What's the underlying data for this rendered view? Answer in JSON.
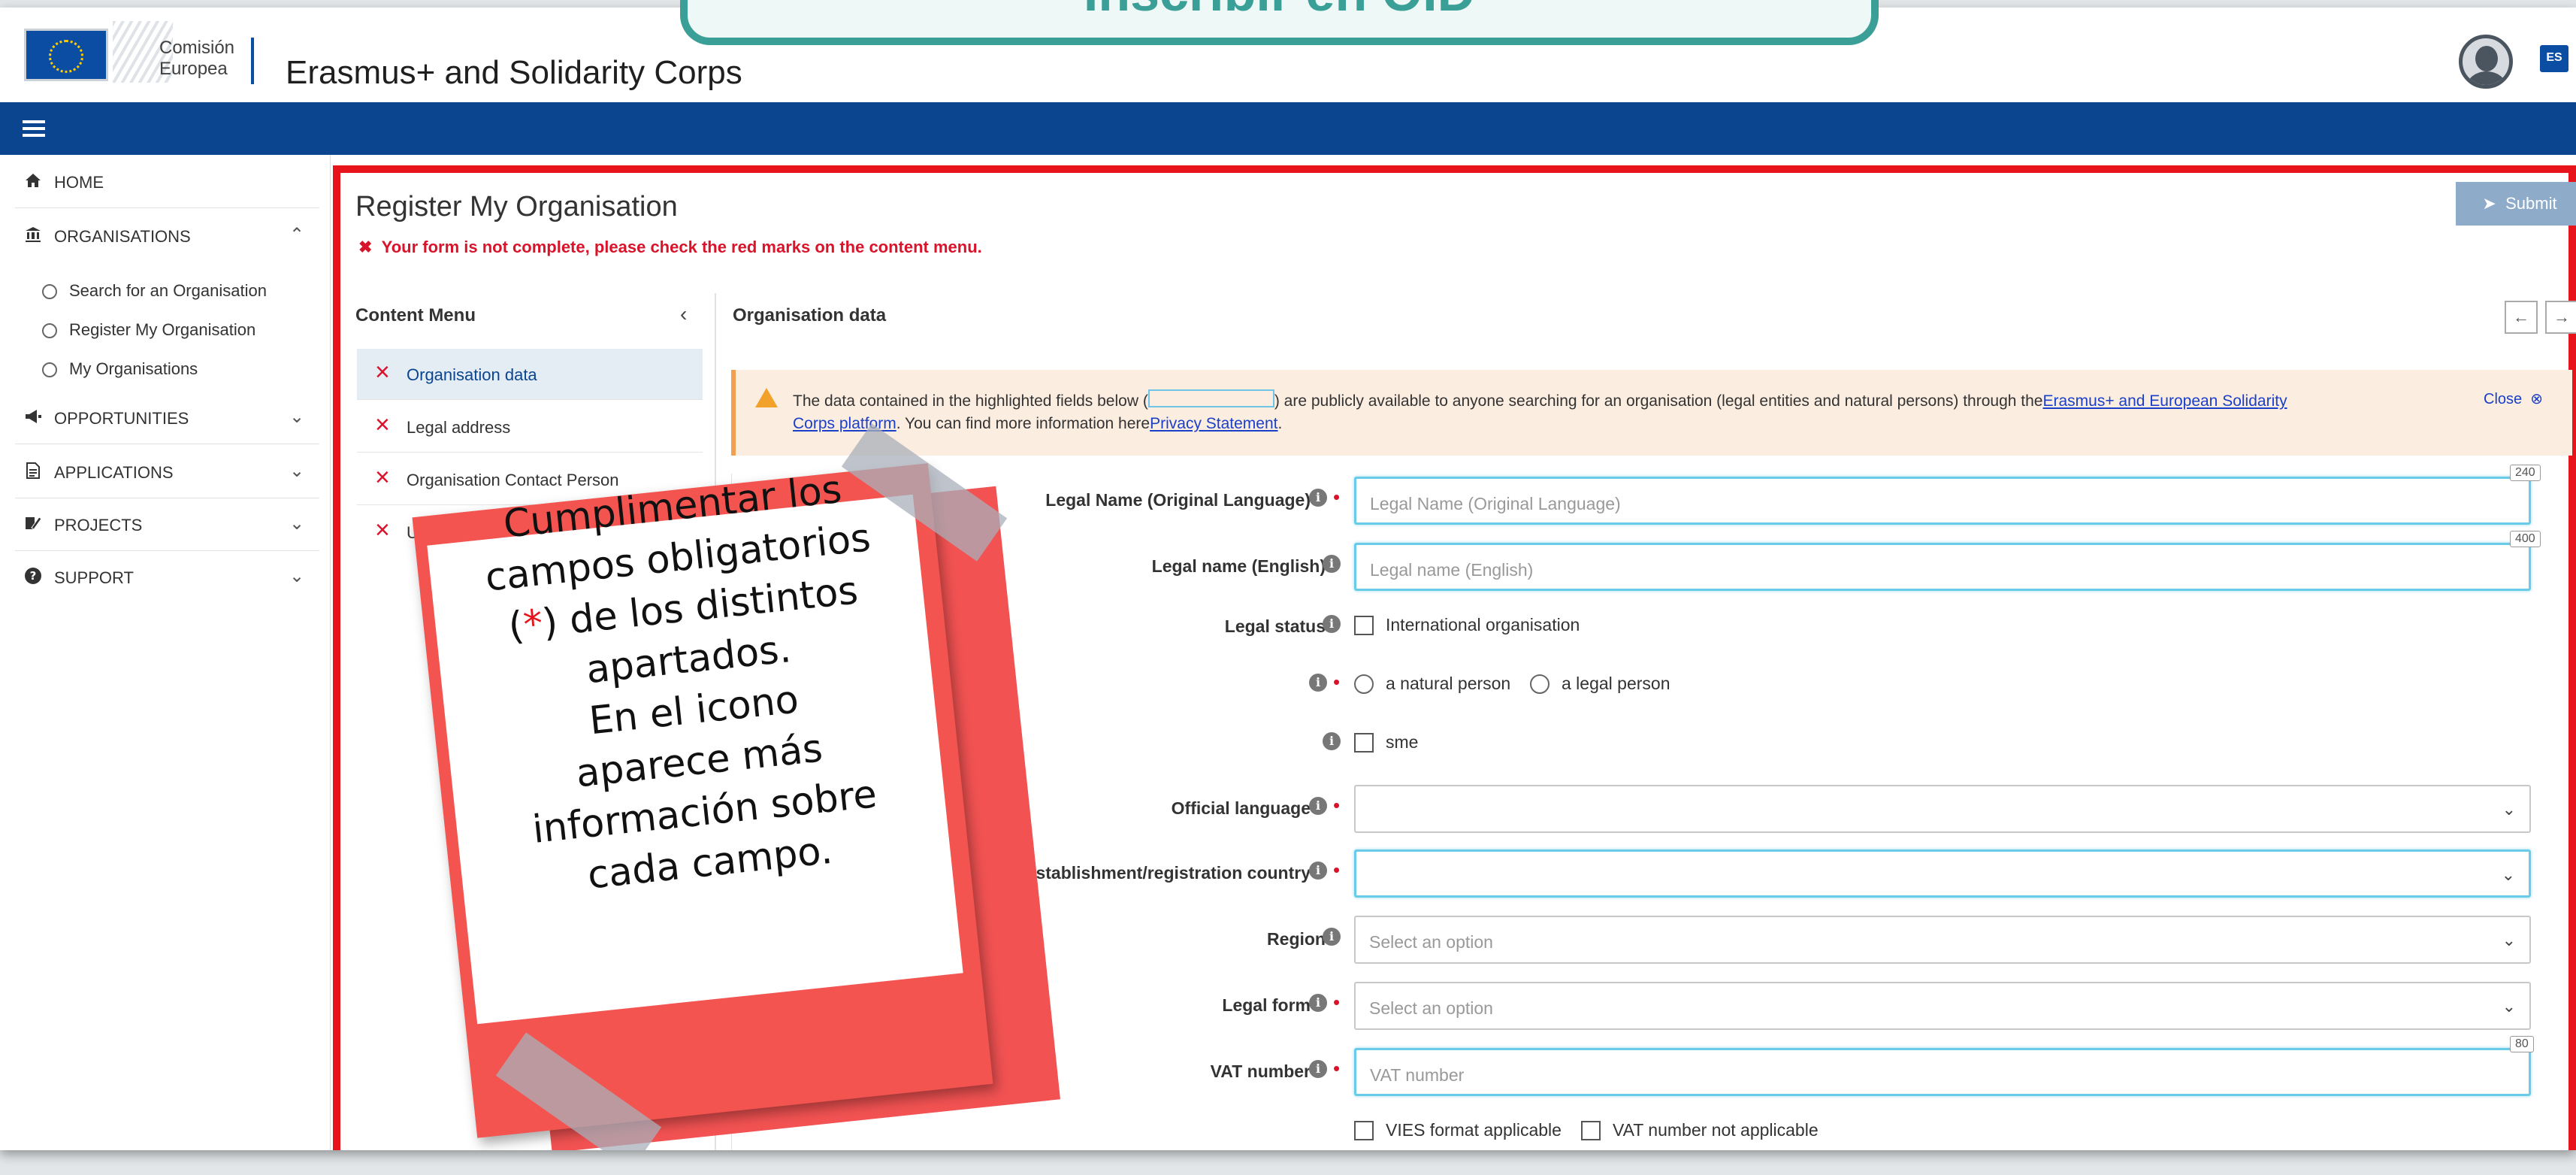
{
  "header": {
    "logo_text_line1": "Comisión",
    "logo_text_line2": "Europea",
    "app_title": "Erasmus+ and Solidarity Corps",
    "lang": "ES"
  },
  "callout": {
    "text": "Inscribir en OID"
  },
  "sidebar": {
    "items": [
      {
        "label": "HOME",
        "icon": "home-icon"
      },
      {
        "label": "ORGANISATIONS",
        "icon": "institution-icon",
        "chevron": "^"
      },
      {
        "label": "OPPORTUNITIES",
        "icon": "megaphone-icon",
        "chevron": "v"
      },
      {
        "label": "APPLICATIONS",
        "icon": "document-icon",
        "chevron": "v"
      },
      {
        "label": "PROJECTS",
        "icon": "edit-icon",
        "chevron": "v"
      },
      {
        "label": "SUPPORT",
        "icon": "question-icon",
        "chevron": "v"
      }
    ],
    "sub_items": [
      "Search for an Organisation",
      "Register My Organisation",
      "My Organisations"
    ]
  },
  "main": {
    "title": "Register My Organisation",
    "error": "Your form is not complete, please check the red marks on the content menu.",
    "submit_label": "Submit"
  },
  "content_menu": {
    "title": "Content Menu",
    "items": [
      "Organisation data",
      "Legal address",
      "Organisation Contact Person",
      "Users"
    ]
  },
  "section": {
    "title": "Organisation data"
  },
  "notice": {
    "text1": "The data contained in the highlighted fields below (",
    "text2": ") are publicly available to anyone searching for an organisation (legal entities and natural persons) through the",
    "link1": "Erasmus+ and European Solidarity",
    "link1b": "Corps platform",
    "text3": ". You can find more information here",
    "link2": "Privacy Statement",
    "text4": ".",
    "close": "Close"
  },
  "form": {
    "legal_name_orig": {
      "label": "Legal Name (Original Language)",
      "placeholder": "Legal Name (Original Language)",
      "max": "240"
    },
    "legal_name_en": {
      "label": "Legal name (English)",
      "placeholder": "Legal name (English)",
      "max": "400"
    },
    "legal_status": {
      "label": "Legal status",
      "checkbox": "International organisation"
    },
    "person_type": {
      "option1": "a natural person",
      "option2": "a legal person"
    },
    "sme": {
      "checkbox": "sme"
    },
    "official_language": {
      "label": "Official language"
    },
    "country": {
      "label": "Establishment/registration country"
    },
    "region": {
      "label": "Region",
      "placeholder": "Select an option"
    },
    "legal_form": {
      "label": "Legal form",
      "placeholder": "Select an option"
    },
    "vat": {
      "label": "VAT number",
      "placeholder": "VAT number",
      "max": "80"
    },
    "vat_checks": {
      "vies": "VIES format applicable",
      "na": "VAT number not applicable"
    }
  },
  "note": {
    "line1": "Cumplimentar los",
    "line2": "campos obligatorios",
    "line3a": "(",
    "line3star": "*",
    "line3b": ") de los distintos",
    "line4": "apartados.",
    "line5": "En el icono",
    "line6": "aparece más",
    "line7": "información sobre",
    "line8": "cada campo."
  }
}
